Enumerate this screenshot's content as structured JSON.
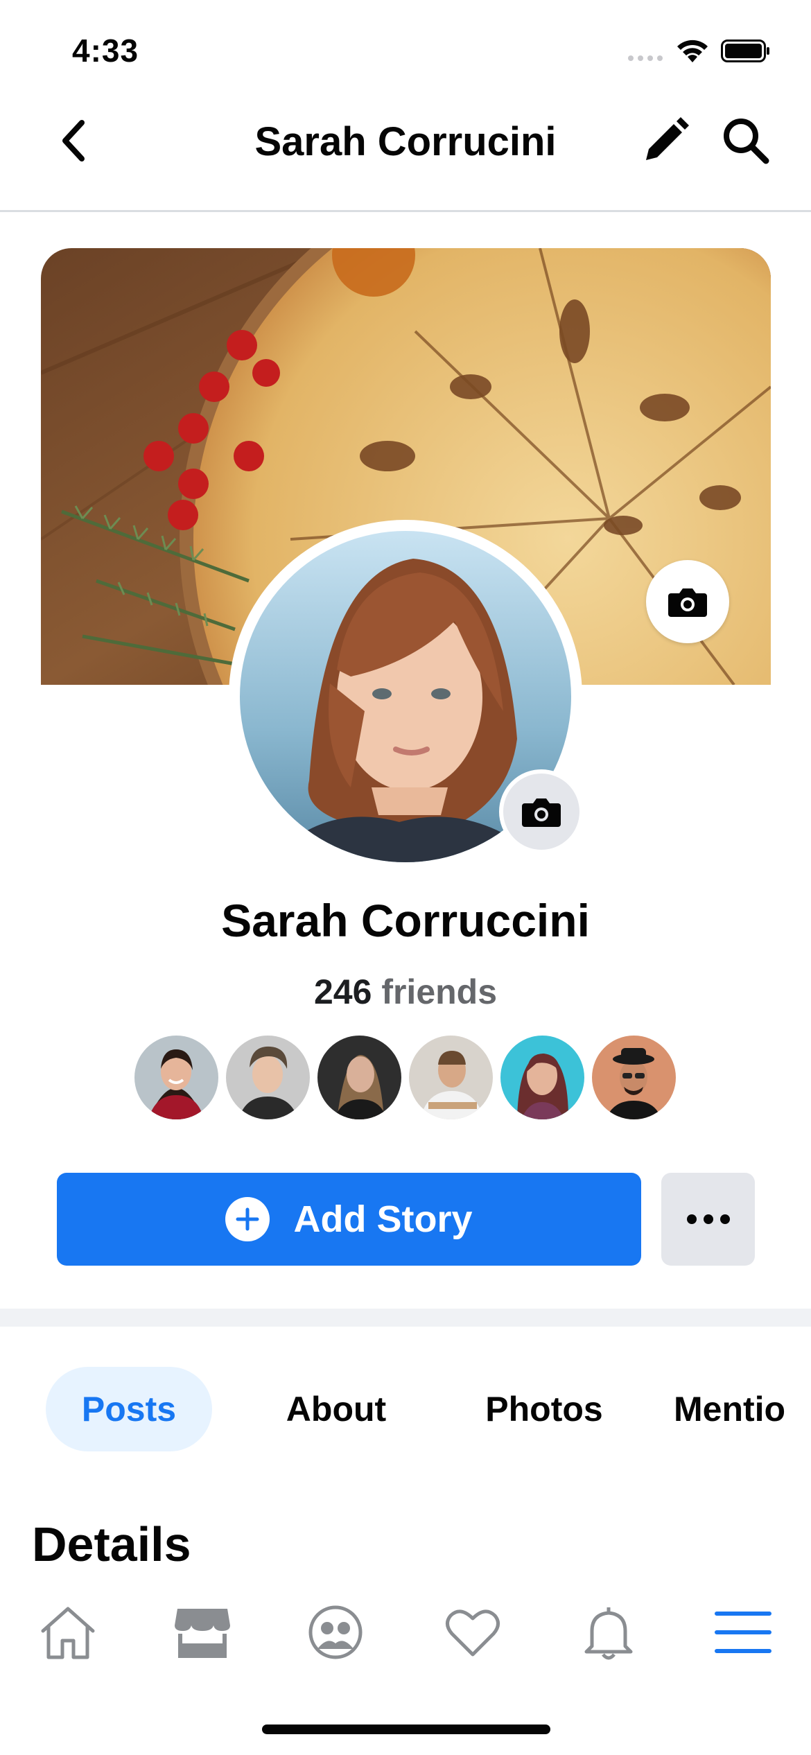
{
  "status_bar": {
    "time": "4:33"
  },
  "header": {
    "title": "Sarah Corrucini"
  },
  "profile": {
    "name": "Sarah Corruccini",
    "friends_count": "246",
    "friends_word": "friends"
  },
  "actions": {
    "add_story_label": "Add Story"
  },
  "tabs": [
    {
      "label": "Posts",
      "active": true
    },
    {
      "label": "About",
      "active": false
    },
    {
      "label": "Photos",
      "active": false
    },
    {
      "label": "Mentio",
      "active": false
    }
  ],
  "sections": {
    "details_title": "Details"
  },
  "bottom_nav": [
    {
      "icon": "home-icon",
      "active": false
    },
    {
      "icon": "marketplace-icon",
      "active": false
    },
    {
      "icon": "groups-icon",
      "active": false
    },
    {
      "icon": "heart-icon",
      "active": false
    },
    {
      "icon": "bell-icon",
      "active": false
    },
    {
      "icon": "menu-icon",
      "active": true
    }
  ],
  "colors": {
    "accent": "#1877f2",
    "accent_light": "#e7f3ff",
    "inactive_icon": "#8a8d91",
    "divider": "#f0f2f5"
  }
}
